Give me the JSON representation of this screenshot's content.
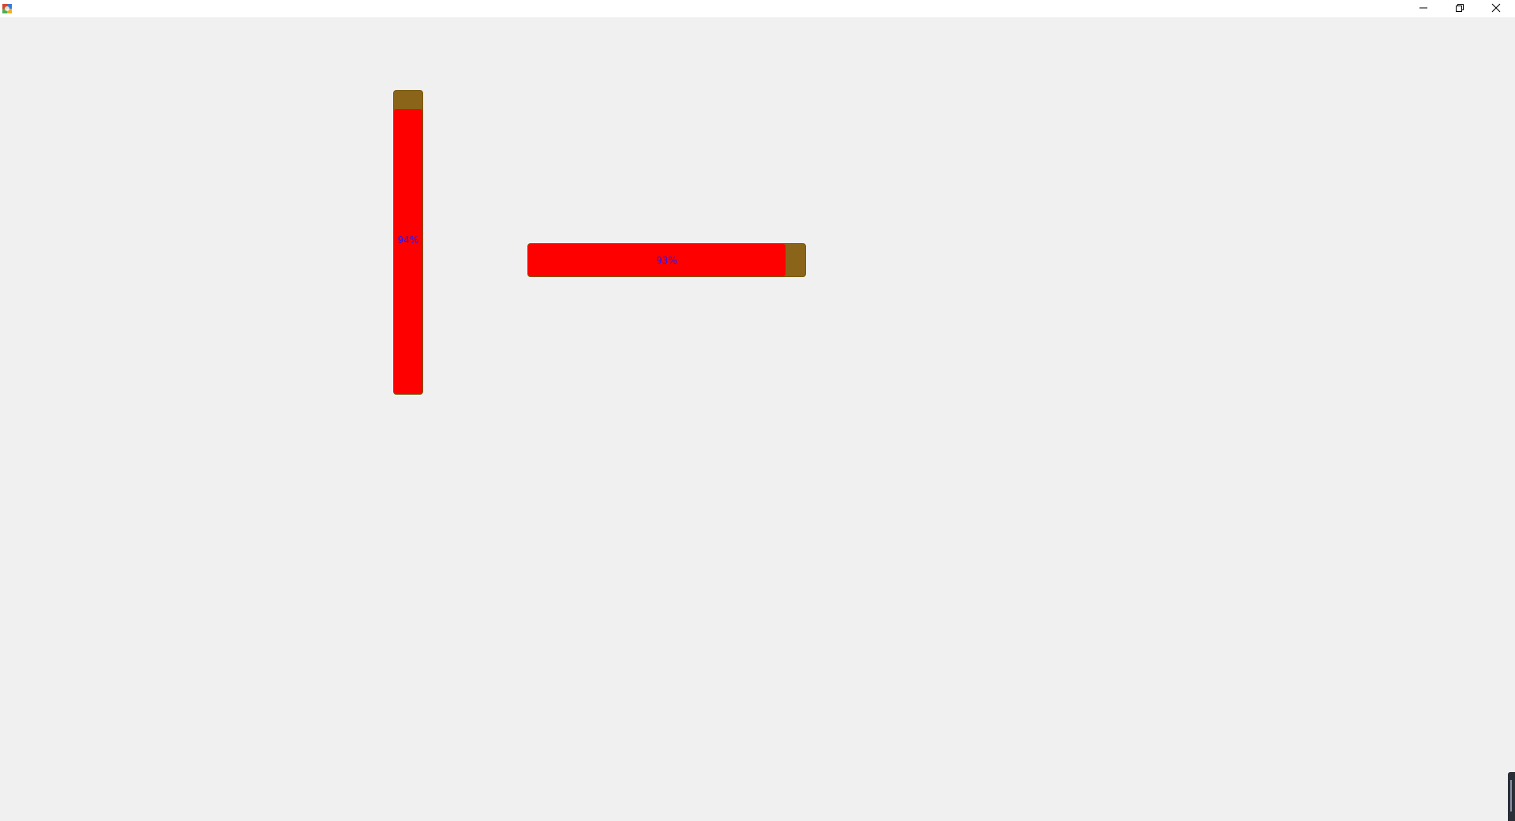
{
  "window": {
    "title": "",
    "controls": {
      "minimize_icon": "minimize-icon",
      "restore_icon": "restore-icon",
      "close_icon": "close-icon"
    }
  },
  "colors": {
    "background": "#f0f0f0",
    "track": "#8a6418",
    "fill": "#ff0000",
    "percent_text": "#1a1aff"
  },
  "progress_bars": {
    "vertical": {
      "value": 0.94,
      "label": "94%"
    },
    "horizontal": {
      "value": 0.93,
      "label": "93%"
    }
  }
}
